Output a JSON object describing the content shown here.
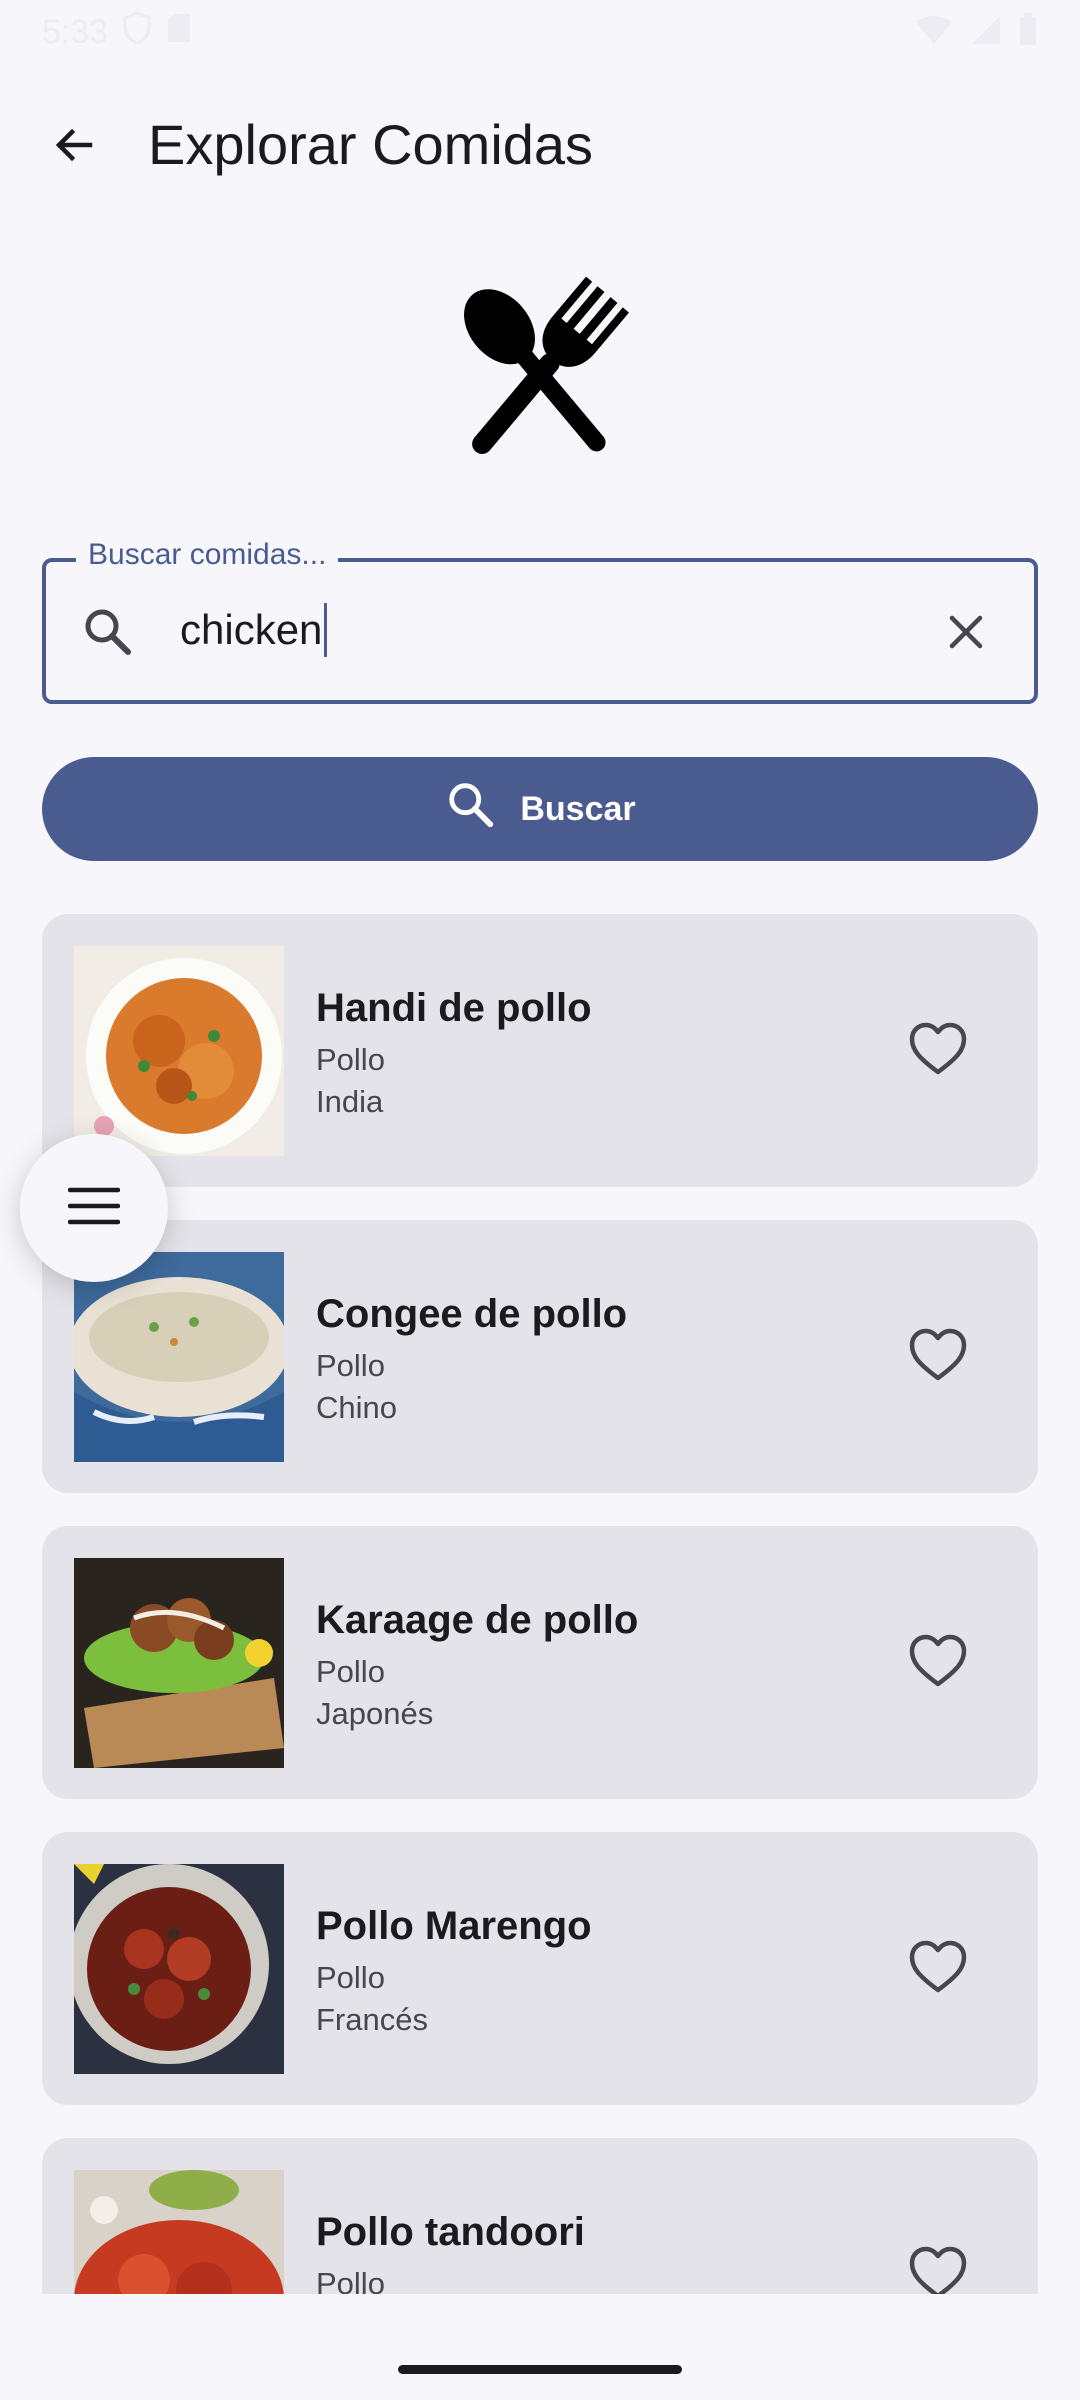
{
  "status_bar": {
    "time": "5:33",
    "left_icons": [
      "shield-icon",
      "sd-card-icon"
    ],
    "right_icons": [
      "wifi-icon",
      "signal-icon",
      "battery-icon"
    ]
  },
  "app_bar": {
    "title": "Explorar Comidas",
    "back_icon": "arrow-back-icon"
  },
  "hero": {
    "icon": "utensils-icon"
  },
  "search": {
    "label": "Buscar comidas...",
    "value": "chicken",
    "leading_icon": "search-icon",
    "trailing_icon": "close-icon"
  },
  "search_button": {
    "label": "Buscar",
    "icon": "search-icon"
  },
  "results": [
    {
      "title": "Handi de pollo",
      "category": "Pollo",
      "area": "India"
    },
    {
      "title": "Congee de pollo",
      "category": "Pollo",
      "area": "Chino"
    },
    {
      "title": "Karaage de pollo",
      "category": "Pollo",
      "area": "Japonés"
    },
    {
      "title": "Pollo Marengo",
      "category": "Pollo",
      "area": "Francés"
    },
    {
      "title": "Pollo tandoori",
      "category": "Pollo",
      "area": ""
    }
  ],
  "fab": {
    "icon": "menu-icon"
  },
  "colors": {
    "primary": "#4a5b8f",
    "background": "#f7f6fb",
    "card": "#e4e3e9",
    "text": "#1b1b1f"
  }
}
